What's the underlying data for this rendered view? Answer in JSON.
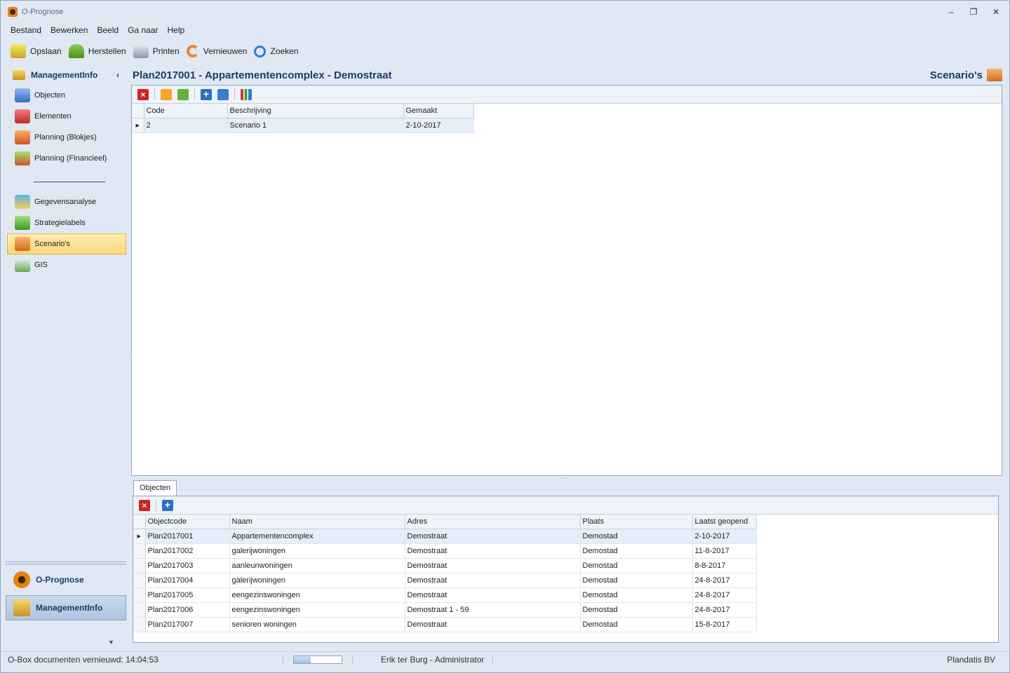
{
  "window": {
    "title": "O-Prognose"
  },
  "menu": [
    "Bestand",
    "Bewerken",
    "Beeld",
    "Ga naar",
    "Help"
  ],
  "toolbar": [
    {
      "label": "Opslaan",
      "icon": "save-icon"
    },
    {
      "label": "Herstellen",
      "icon": "undo-icon"
    },
    {
      "label": "Printen",
      "icon": "printer-icon"
    },
    {
      "label": "Vernieuwen",
      "icon": "refresh-icon"
    },
    {
      "label": "Zoeken",
      "icon": "search-icon"
    }
  ],
  "sidebar": {
    "header": "ManagementInfo",
    "items": [
      {
        "label": "Objecten",
        "icon": "objects-icon"
      },
      {
        "label": "Elementen",
        "icon": "elements-icon"
      },
      {
        "label": "Planning (Blokjes)",
        "icon": "planning-blocks-icon"
      },
      {
        "label": "Planning (Financieel)",
        "icon": "planning-financial-icon"
      },
      {
        "label": "Gegevensanalyse",
        "icon": "data-analysis-icon"
      },
      {
        "label": "Strategielabels",
        "icon": "strategy-labels-icon"
      },
      {
        "label": "Scenario's",
        "icon": "scenarios-icon",
        "selected": true
      },
      {
        "label": "GIS",
        "icon": "gis-icon"
      }
    ],
    "bottom": [
      {
        "label": "O-Prognose",
        "icon": "o-prognose-icon"
      },
      {
        "label": "ManagementInfo",
        "icon": "management-info-icon",
        "active": true
      }
    ]
  },
  "main": {
    "title": "Plan2017001 - Appartementencomplex - Demostraat",
    "section": "Scenario's"
  },
  "scenarios": {
    "columns": [
      "Code",
      "Beschrijving",
      "Gemaakt"
    ],
    "rows": [
      [
        "2",
        "Scenario 1",
        "2-10-2017"
      ]
    ]
  },
  "detail": {
    "tab": "Objecten",
    "columns": [
      "Objectcode",
      "Naam",
      "Adres",
      "Plaats",
      "Laatst geopend"
    ],
    "rows": [
      [
        "Plan2017001",
        "Appartementencomplex",
        "Demostraat",
        "Demostad",
        "2-10-2017"
      ],
      [
        "Plan2017002",
        "galerijwoningen",
        "Demostraat",
        "Demostad",
        "11-8-2017"
      ],
      [
        "Plan2017003",
        "aanleunwoningen",
        "Demostraat",
        "Demostad",
        "8-8-2017"
      ],
      [
        "Plan2017004",
        "galerijwoningen",
        "Demostraat",
        "Demostad",
        "24-8-2017"
      ],
      [
        "Plan2017005",
        "eengezinswoningen",
        "Demostraat",
        "Demostad",
        "24-8-2017"
      ],
      [
        "Plan2017006",
        "eengezinswoningen",
        "Demostraat 1 - 59",
        "Demostad",
        "24-8-2017"
      ],
      [
        "Plan2017007",
        "senioren woningen",
        "Demostraat",
        "Demostad",
        "15-8-2017"
      ]
    ]
  },
  "status": {
    "left": "O-Box documenten vernieuwd: 14:04:53",
    "user": "Erik ter Burg - Administrator",
    "company": "Plandatis BV",
    "progress": 0.35
  }
}
